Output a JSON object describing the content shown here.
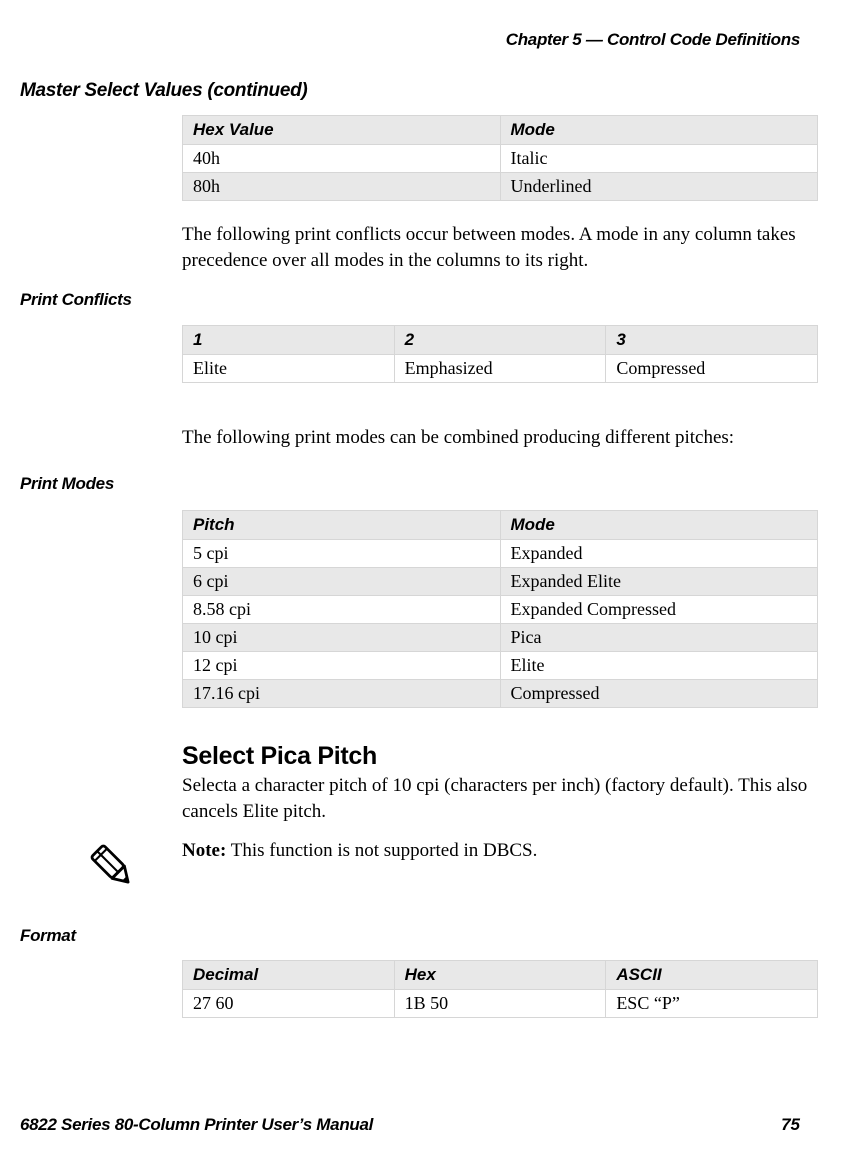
{
  "header": {
    "chapter": "Chapter 5 — Control Code Definitions"
  },
  "continued_title": "Master Select Values  (continued)",
  "master_table": {
    "headers": [
      "Hex Value",
      "Mode"
    ],
    "rows": [
      {
        "c1": "40h",
        "c2": "Italic"
      },
      {
        "c1": "80h",
        "c2": "Underlined"
      }
    ]
  },
  "para1": "The following print conflicts occur between modes. A mode in any column takes precedence over all modes in the columns to its right.",
  "conflicts_label": "Print Conflicts",
  "conflicts_table": {
    "headers": [
      "1",
      "2",
      "3"
    ],
    "rows": [
      {
        "c1": "Elite",
        "c2": "Emphasized",
        "c3": "Compressed"
      }
    ]
  },
  "para2": "The following print modes can be combined producing different pitches:",
  "modes_label": "Print Modes",
  "modes_table": {
    "headers": [
      "Pitch",
      "Mode"
    ],
    "rows": [
      {
        "c1": "5 cpi",
        "c2": "Expanded"
      },
      {
        "c1": "6 cpi",
        "c2": "Expanded Elite"
      },
      {
        "c1": "8.58 cpi",
        "c2": "Expanded Compressed"
      },
      {
        "c1": "10 cpi",
        "c2": "Pica"
      },
      {
        "c1": "12 cpi",
        "c2": "Elite"
      },
      {
        "c1": "17.16 cpi",
        "c2": "Compressed"
      }
    ]
  },
  "pica_heading": "Select Pica Pitch",
  "pica_body": "Selecta a character pitch of 10 cpi (characters per inch) (factory default). This also cancels Elite pitch.",
  "note": {
    "label": "Note:",
    "text": " This function is not supported in DBCS."
  },
  "format_label": "Format",
  "format_table": {
    "headers": [
      "Decimal",
      "Hex",
      "ASCII"
    ],
    "rows": [
      {
        "c1": "27 60",
        "c2": "1B 50",
        "c3": "ESC “P”"
      }
    ]
  },
  "footer": {
    "manual": "6822 Series 80-Column Printer User’s Manual",
    "page": "75"
  }
}
